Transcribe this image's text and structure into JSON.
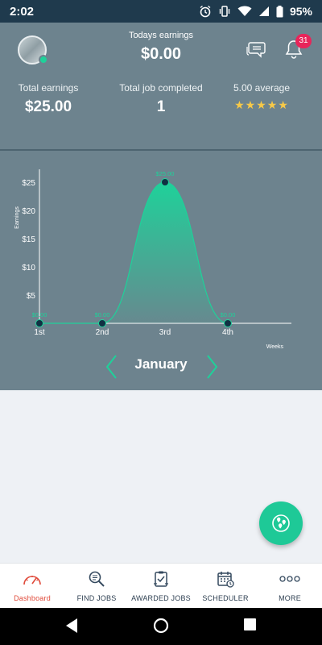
{
  "status_bar": {
    "time": "2:02",
    "battery": "95%"
  },
  "header": {
    "today_label": "Todays earnings",
    "today_value": "$0.00",
    "notification_count": "31"
  },
  "stats": {
    "total_earnings_label": "Total earnings",
    "total_earnings_value": "$25.00",
    "jobs_completed_label": "Total job completed",
    "jobs_completed_value": "1",
    "rating_label": "5.00 average",
    "rating_stars": 5,
    "stars_glyph": "★★★★★"
  },
  "chart_data": {
    "type": "area",
    "categories": [
      "1st",
      "2nd",
      "3rd",
      "4th"
    ],
    "values": [
      0,
      0,
      25,
      0
    ],
    "data_labels": [
      "$0.00",
      "$0.00",
      "$25.00",
      "$0.00"
    ],
    "y_tick_labels": [
      "$5",
      "$10",
      "$15",
      "$20",
      "$25"
    ],
    "y_ticks": [
      5,
      10,
      15,
      20,
      25
    ],
    "ylim": [
      0,
      28
    ],
    "ylabel": "Earnings",
    "xlabel": "Weeks",
    "line_color": "#1fd19a",
    "grid": false
  },
  "month_nav": {
    "month": "January"
  },
  "bottom_nav": {
    "items": [
      {
        "label": "Dashboard",
        "icon": "speedometer-icon",
        "active": true
      },
      {
        "label": "FIND JOBS",
        "icon": "search-document-icon",
        "active": false
      },
      {
        "label": "AWARDED JOBS",
        "icon": "awarded-clipboard-icon",
        "active": false
      },
      {
        "label": "SCHEDULER",
        "icon": "calendar-icon",
        "active": false
      },
      {
        "label": "MORE",
        "icon": "more-dots-icon",
        "active": false
      }
    ]
  },
  "colors": {
    "panel": "#6d838e",
    "accent": "#1ec997",
    "badge": "#e8255a",
    "active_nav": "#e04a3a",
    "star": "#f7c948"
  }
}
